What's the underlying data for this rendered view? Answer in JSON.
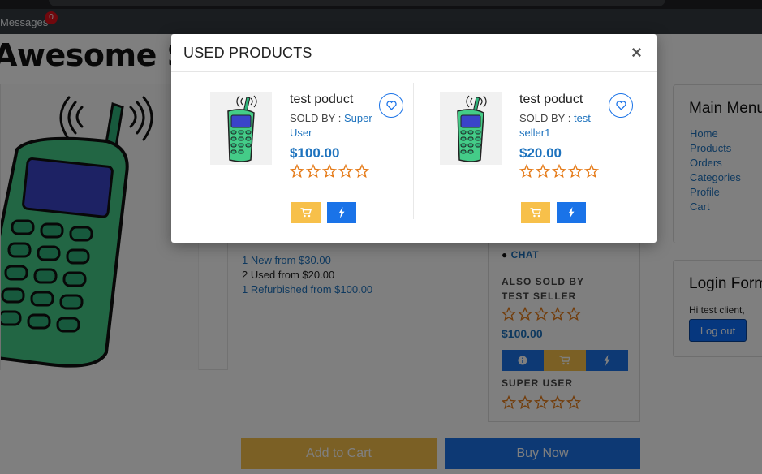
{
  "topnav": {
    "messages_label": "Messages",
    "messages_count": "0"
  },
  "store": {
    "title": "Awesome Store"
  },
  "offers": {
    "new": "1 New from $30.00",
    "used": "2 Used from $20.00",
    "refurbished": "1 Refurbished from $100.00"
  },
  "seller_card": {
    "chat_label": "CHAT",
    "also_sold_by": "ALSO SOLD BY",
    "seller_name": "TEST SELLER",
    "price": "$100.00",
    "second_seller": "SUPER USER"
  },
  "actions": {
    "add_to_cart": "Add to Cart",
    "buy_now": "Buy Now"
  },
  "main_menu": {
    "title": "Main Menu",
    "items": [
      "Home",
      "Products",
      "Orders",
      "Categories",
      "Profile",
      "Cart"
    ]
  },
  "login": {
    "title": "Login Form",
    "greeting": "Hi test client,",
    "logout_label": "Log out"
  },
  "modal": {
    "title": "USED PRODUCTS",
    "close": "×",
    "products": [
      {
        "name": "test poduct",
        "sold_by_label": "SOLD BY :",
        "seller": "Super User",
        "price": "$100.00",
        "rating": 0
      },
      {
        "name": "test poduct",
        "sold_by_label": "SOLD BY :",
        "seller": "test seller1",
        "price": "$20.00",
        "rating": 0
      }
    ]
  },
  "colors": {
    "accent_blue": "#1a73e8",
    "link_blue": "#1e73be",
    "cart_orange": "#f7c04a",
    "badge_red": "#e0101b"
  },
  "icons": [
    "heart-icon",
    "cart-icon",
    "bolt-icon",
    "info-icon",
    "star-outline-icon",
    "comment-icon",
    "close-icon"
  ]
}
